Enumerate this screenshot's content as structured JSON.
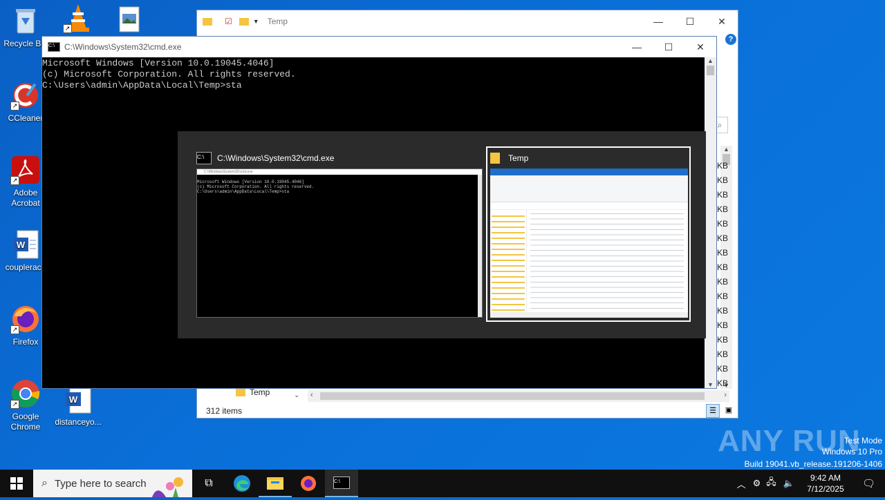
{
  "desktop_icons": [
    {
      "label": "Recycle Bin",
      "name": "recycle-bin"
    },
    {
      "label": "CCleaner",
      "name": "ccleaner"
    },
    {
      "label": "Adobe Acrobat",
      "name": "adobe-acrobat"
    },
    {
      "label": "couplerace",
      "name": "couplerace"
    },
    {
      "label": "Firefox",
      "name": "firefox"
    },
    {
      "label": "Google Chrome",
      "name": "google-chrome"
    },
    {
      "label": "distanceyo...",
      "name": "distanceyo"
    }
  ],
  "explorer": {
    "title": "Temp",
    "status": "312 items",
    "nav_item": "Temp",
    "size_unit": "KB",
    "size_rows": 16
  },
  "cmd": {
    "title": "C:\\Windows\\System32\\cmd.exe",
    "lines": [
      "Microsoft Windows [Version 10.0.19045.4046]",
      "(c) Microsoft Corporation. All rights reserved.",
      "",
      "C:\\Users\\admin\\AppData\\Local\\Temp>sta"
    ]
  },
  "alttab": {
    "tiles": [
      {
        "title": "C:\\Windows\\System32\\cmd.exe",
        "selected": false
      },
      {
        "title": "Temp",
        "selected": true
      }
    ],
    "thumb_cmd_lines": [
      "Microsoft Windows [Version 10.0.19045.4046]",
      "(c) Microsoft Corporation. All rights reserved.",
      "",
      "C:\\Users\\admin\\AppData\\Local\\Temp>sta"
    ]
  },
  "taskbar": {
    "search_placeholder": "Type here to search",
    "time": "9:42 AM",
    "date": "7/12/2025"
  },
  "watermark": {
    "brand": "ANY RUN",
    "line1": "Test Mode",
    "line2": "Windows 10 Pro",
    "line3": "Build 19041.vb_release.191206-1406"
  }
}
